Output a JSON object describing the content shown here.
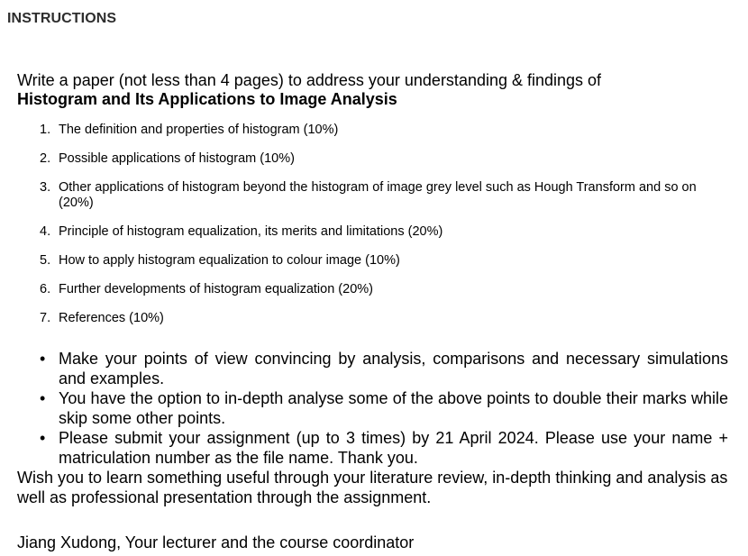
{
  "heading": "INSTRUCTIONS",
  "intro": {
    "line1": "Write a paper (not less than 4 pages) to address your understanding & findings of",
    "topic": "Histogram and Its Applications to Image Analysis"
  },
  "topics": [
    {
      "num": "1.",
      "text": "The definition and properties of histogram (10%)"
    },
    {
      "num": "2.",
      "text": "Possible applications of histogram (10%)"
    },
    {
      "num": "3.",
      "text": "Other applications of histogram beyond the histogram of image grey level such as Hough Transform and so on (20%)"
    },
    {
      "num": "4.",
      "text": "Principle of histogram equalization, its merits and limitations (20%)"
    },
    {
      "num": "5.",
      "text": "How to apply histogram equalization to colour image (10%)"
    },
    {
      "num": "6.",
      "text": "Further developments of histogram equalization (20%)"
    },
    {
      "num": "7.",
      "text": "References (10%)"
    }
  ],
  "bullets": [
    "Make your points of view convincing by analysis, comparisons and necessary simulations and examples.",
    "You have the option to in-depth analyse some of the above points to double their marks while skip some other points.",
    "Please submit your assignment (up to 3 times) by 21 April 2024. Please use your name + matriculation number as the file name. Thank you."
  ],
  "bullet_glyph": "•",
  "closing": "Wish you to learn something useful through your literature review, in-depth thinking and analysis as well as professional presentation through the assignment.",
  "signature": "Jiang Xudong, Your lecturer and the course coordinator"
}
